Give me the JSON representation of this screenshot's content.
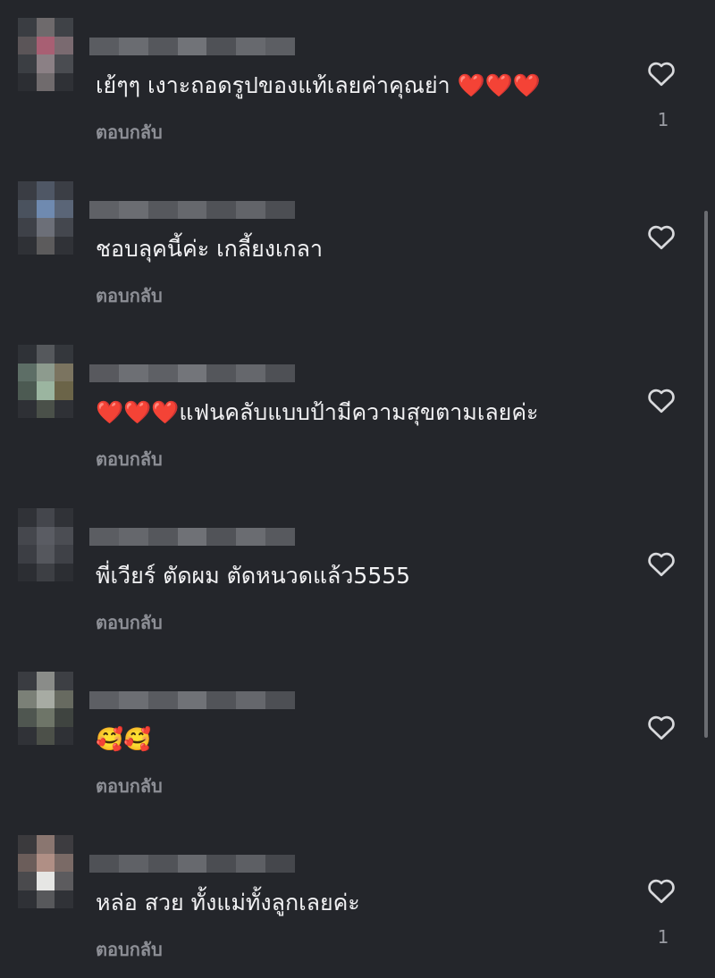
{
  "reply_label": "ตอบกลับ",
  "comments": [
    {
      "text": "เย้ๆๆ  เงาะถอดรูปของแท้เลยค่าคุณย่า ❤️❤️❤️",
      "like_count": "1"
    },
    {
      "text": "ชอบลุคนี้ค่ะ เกลี้ยงเกลา",
      "like_count": ""
    },
    {
      "text": "❤️❤️❤️แฟนคลับแบบป้ามีความสุขตามเลยค่ะ",
      "like_count": ""
    },
    {
      "text": "พี่เวียร์ ตัดผม ตัดหนวดแล้ว5555",
      "like_count": ""
    },
    {
      "text": "🥰🥰",
      "like_count": ""
    },
    {
      "text": "หล่อ สวย ทั้งแม่ทั้งลูกเลยค่ะ",
      "like_count": "1"
    }
  ],
  "icons": {
    "like": "heart-outline-icon"
  },
  "colors": {
    "background": "#24262b",
    "text": "#f1f1f3",
    "secondary": "#8d8f96"
  }
}
